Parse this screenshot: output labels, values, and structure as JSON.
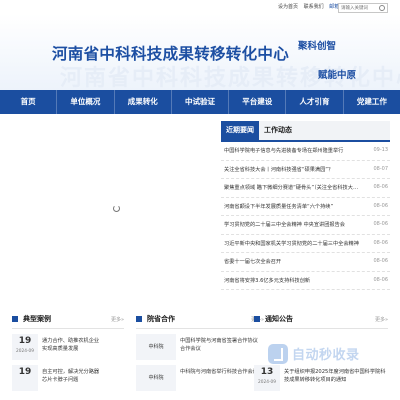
{
  "topbar": {
    "links": [
      "设为首页",
      "联系我们",
      "邮箱"
    ],
    "search_placeholder": "请输入关键词"
  },
  "banner": {
    "title": "河南省中科科技成果转移转化中心",
    "slogan_line1": "聚科创智",
    "slogan_line2": "赋能中原"
  },
  "nav": [
    "首页",
    "单位概况",
    "成果转化",
    "中试验证",
    "平台建设",
    "人才引育",
    "党建工作"
  ],
  "news": {
    "tabs": [
      "近期要闻",
      "工作动态"
    ],
    "items": [
      {
        "title": "中国科学院电子信息与先进装备专场在郑州隆重举行",
        "date": "09-13"
      },
      {
        "title": "关注全省科技大会丨河南科技强省“硕果满园”？",
        "date": "08-07"
      },
      {
        "title": "聚焦重点领域 瞄下微细分赛道“硬骨头”（关注全省科技大会）",
        "date": "08-06"
      },
      {
        "title": "河南省颠设下半年发展质量任务清单“六个持续”",
        "date": "08-06"
      },
      {
        "title": "学习贯彻党的二十届三中全会精神 中央宣讲团报告会",
        "date": "08-06"
      },
      {
        "title": "习近平新中央和国家机关学习贯彻党的二十届三中全会精神",
        "date": "08-06"
      },
      {
        "title": "省委十一届七次全会召开",
        "date": "08-06"
      },
      {
        "title": "河南省将安排3.6亿多元支持科技创新",
        "date": "08-06"
      }
    ]
  },
  "cases": {
    "title": "典型案例",
    "more": "更多»",
    "items": [
      {
        "day": "19",
        "ym": "2024-09",
        "text": "通力合作、助推农机企业实现高质量发展"
      },
      {
        "day": "19",
        "ym": "",
        "text": "自主可控，解决光分路器芯片卡脖子问题"
      }
    ]
  },
  "coop": {
    "title": "院省合作",
    "more": "更多»",
    "items": [
      {
        "org": "中科院",
        "text": "中国科学院与河南省签署合作协议 合作会议"
      },
      {
        "org": "中科院",
        "text": "中科院与河南省举行科技合作会议"
      }
    ]
  },
  "notice": {
    "title": "通知公告",
    "more": "更多»",
    "items": [
      {
        "day": "13",
        "ym": "2024-09",
        "text": "关于组织申报2025年度河南省中国科学院科技成果转移转化项目的通知"
      }
    ]
  },
  "watermark": "自动秒收录",
  "colors": {
    "brand": "#1b4ea0",
    "accent": "#1d4fa3"
  }
}
